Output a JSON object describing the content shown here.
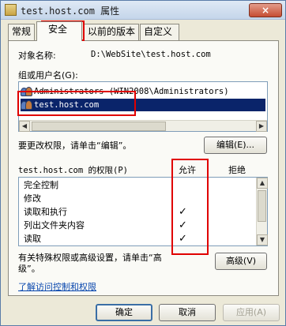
{
  "window": {
    "title": "test.host.com 属性",
    "close_symbol": "×"
  },
  "tabs": [
    {
      "label": "常规",
      "active": false
    },
    {
      "label": "安全",
      "active": true
    },
    {
      "label": "以前的版本",
      "active": false
    },
    {
      "label": "自定义",
      "active": false
    }
  ],
  "security": {
    "object_name_label": "对象名称:",
    "object_name_value": "D:\\WebSite\\test.host.com",
    "groups_label": "组或用户名(G):",
    "groups": [
      {
        "name": "Administrators (WIN2008\\Administrators)",
        "selected": false
      },
      {
        "name": "test.host.com",
        "selected": true
      }
    ],
    "edit_hint": "要更改权限，请单击“编辑”。",
    "edit_button": "编辑(E)...",
    "permissions_label": "test.host.com 的权限(P)",
    "allow_header": "允许",
    "deny_header": "拒绝",
    "permissions": [
      {
        "name": "完全控制",
        "allow": false
      },
      {
        "name": "修改",
        "allow": false
      },
      {
        "name": "读取和执行",
        "allow": true
      },
      {
        "name": "列出文件夹内容",
        "allow": true
      },
      {
        "name": "读取",
        "allow": true
      }
    ],
    "check_symbol": "✓",
    "advanced_hint_line1": "有关特殊权限或高级设置，请单击“高",
    "advanced_hint_line2": "级”。",
    "advanced_button": "高级(V)",
    "learn_link": "了解访问控制和权限"
  },
  "footer": {
    "ok": "确定",
    "cancel": "取消",
    "apply": "应用(A)"
  },
  "scroll_arrows": {
    "left": "◀",
    "right": "▶",
    "up": "▲",
    "down": "▼"
  }
}
